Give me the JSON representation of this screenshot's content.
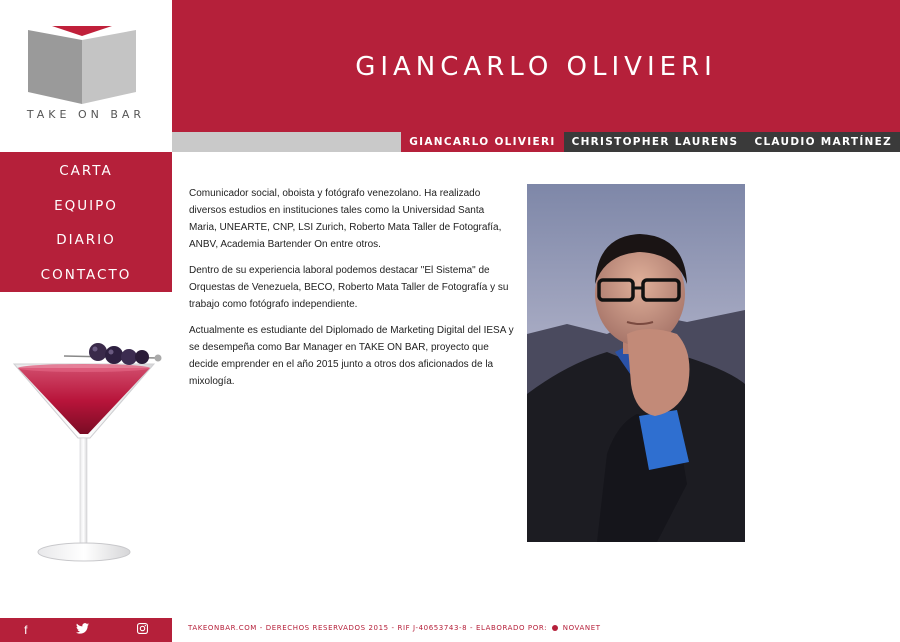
{
  "logo": {
    "text": "TAKE ON BAR"
  },
  "nav": {
    "items": [
      {
        "label": "CARTA"
      },
      {
        "label": "EQUIPO"
      },
      {
        "label": "DIARIO"
      },
      {
        "label": "CONTACTO"
      }
    ]
  },
  "header": {
    "title": "GIANCARLO OLIVIERI"
  },
  "team_tabs": [
    {
      "label": "GIANCARLO OLIVIERI",
      "active": true
    },
    {
      "label": "CHRISTOPHER LAURENS",
      "active": false
    },
    {
      "label": "CLAUDIO MARTÍNEZ",
      "active": false
    }
  ],
  "bio": {
    "paragraphs": [
      "Comunicador social, oboista y fotógrafo venezolano. Ha realizado diversos estudios en instituciones tales como la Universidad Santa Maria, UNEARTE, CNP, LSI Zurich, Roberto Mata Taller de Fotografía, ANBV, Academia Bartender On entre otros.",
      "Dentro de su experiencia laboral podemos destacar \"El Sistema\" de Orquestas de Venezuela, BECO, Roberto Mata Taller de Fotografía y su trabajo como fotógrafo independiente.",
      "Actualmente es estudiante del Diplomado de Marketing Digital del IESA y se desempeña como Bar Manager en TAKE ON BAR, proyecto que decide emprender en el año 2015 junto a otros dos aficionados de la mixología."
    ]
  },
  "social": {
    "facebook": "f",
    "twitter": "t",
    "instagram": "◘"
  },
  "footer": {
    "text": "TAKEONBAR.COM - DERECHOS RESERVADOS 2015 - RIF J-40653743-8 - ELABORADO POR:",
    "brand": "NOVANET"
  },
  "colors": {
    "accent": "#b5203a",
    "dark": "#3a3a3a",
    "grey": "#c9c9c9"
  }
}
